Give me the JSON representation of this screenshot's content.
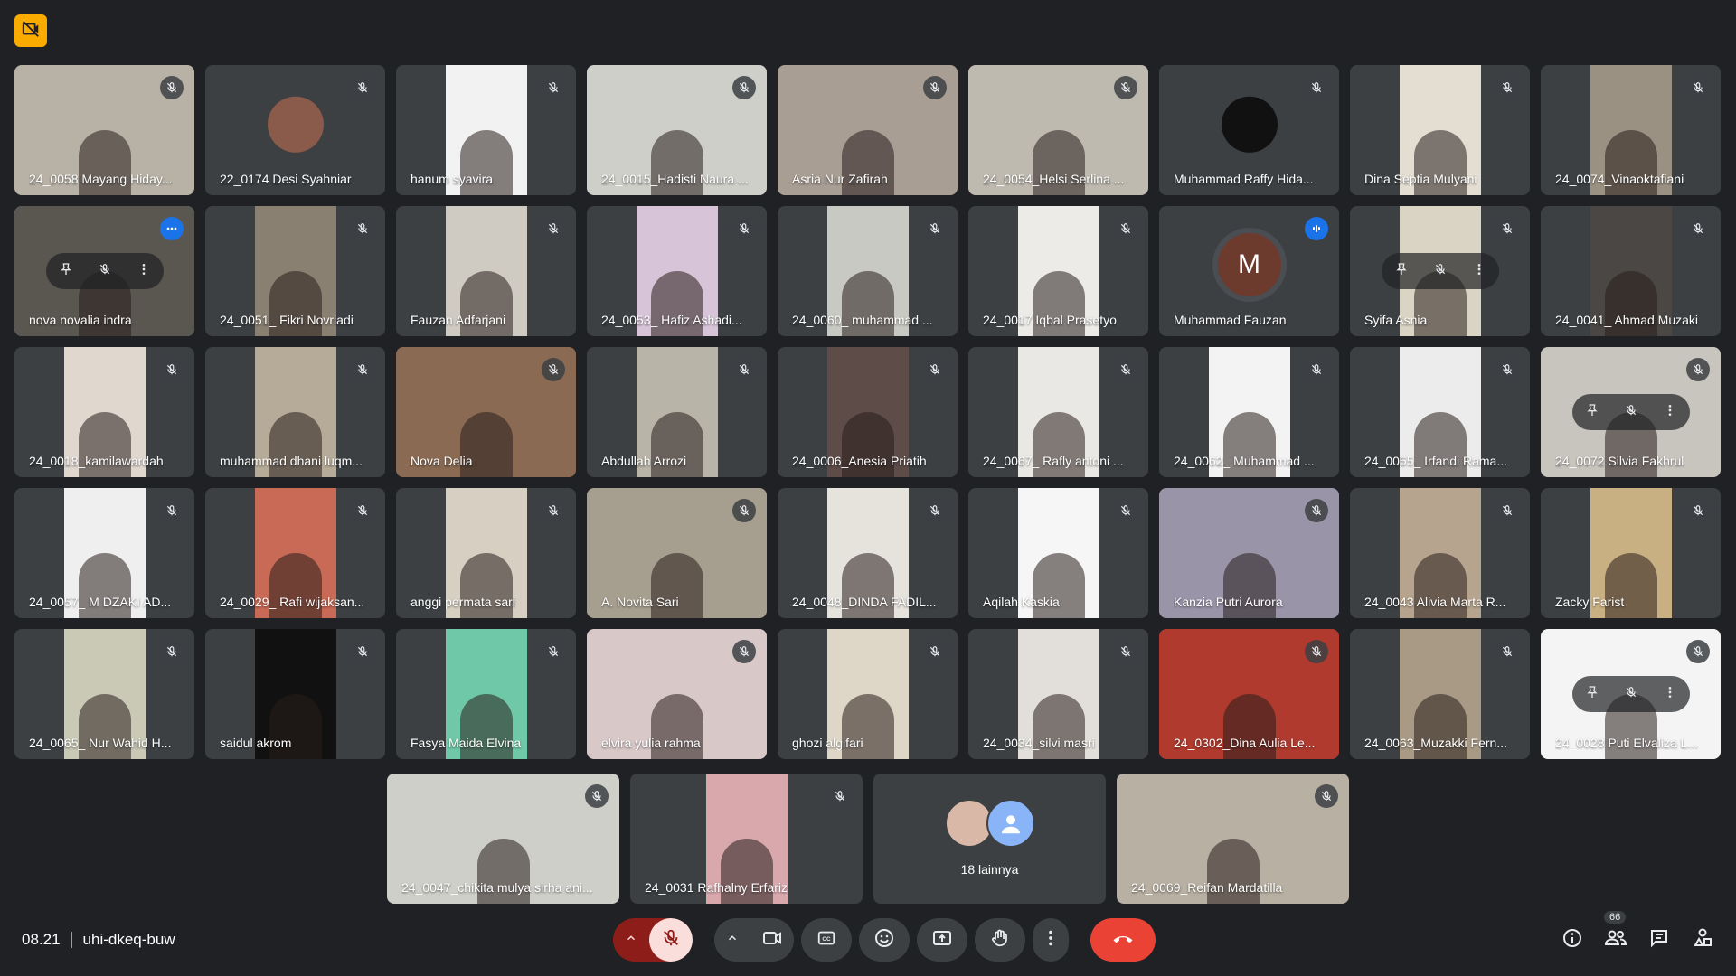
{
  "meeting": {
    "time": "08.21",
    "code": "uhi-dkeq-buw"
  },
  "participant_count": "66",
  "others_label": "18 lainnya",
  "colors": {
    "tile_bg": "#3c4043",
    "page_bg": "#202124",
    "end_call": "#ea4335",
    "active_border": "#8ab4f8",
    "speaking": "#1a73e8"
  },
  "participants": [
    {
      "name": "24_0058 Mayang Hiday...",
      "mode": "full",
      "bg": "#b8b2a6"
    },
    {
      "name": "22_0174 Desi Syahniar",
      "mode": "avatar",
      "avatar": "#8a5a4a"
    },
    {
      "name": "hanum syavira",
      "mode": "video",
      "bg": "#f2f2f2"
    },
    {
      "name": "24_0015_Hadisti Naura ...",
      "mode": "full",
      "bg": "#cfcfca"
    },
    {
      "name": "Asria Nur Zafirah",
      "mode": "full",
      "bg": "#a99e94"
    },
    {
      "name": "24_0054_Helsi Serlina ...",
      "mode": "full",
      "bg": "#bfbab0"
    },
    {
      "name": "Muhammad Raffy Hida...",
      "mode": "avatar",
      "avatar": "#111111"
    },
    {
      "name": "Dina Septia Mulyani",
      "mode": "video",
      "bg": "#e3ddd2"
    },
    {
      "name": "24_0074_Vinaoktafiani",
      "mode": "video",
      "bg": "#9a9182"
    },
    {
      "name": "nova novalia indra",
      "mode": "full",
      "bg": "#5a5650",
      "active": true,
      "badge": "more",
      "hover": true
    },
    {
      "name": "24_0051_ Fikri Novriadi",
      "mode": "video",
      "bg": "#8a8072"
    },
    {
      "name": "Fauzan Adfarjani",
      "mode": "video",
      "bg": "#cfcac2"
    },
    {
      "name": "24_0053_ Hafiz Ashadi...",
      "mode": "video",
      "bg": "#d7c4d8"
    },
    {
      "name": "24_0060_ muhammad ...",
      "mode": "video",
      "bg": "#c9c9c4"
    },
    {
      "name": "24_0017 Iqbal Prasetyo",
      "mode": "video",
      "bg": "#ecebe8"
    },
    {
      "name": "Muhammad Fauzan",
      "mode": "letter",
      "letter": "M",
      "avatar": "#6d3a2e",
      "badge": "speak"
    },
    {
      "name": "Syifa Asnia",
      "mode": "video",
      "bg": "#dad4c4",
      "hover": true
    },
    {
      "name": "24_0041_ Ahmad Muzaki",
      "mode": "video",
      "bg": "#4a4744"
    },
    {
      "name": "24_0018_kamilawardah",
      "mode": "video",
      "bg": "#e0d7cf"
    },
    {
      "name": "muhammad dhani luqm...",
      "mode": "video",
      "bg": "#b6ab98"
    },
    {
      "name": "Nova Delia",
      "mode": "full",
      "bg": "#8a6a52"
    },
    {
      "name": "Abdullah Arrozi",
      "mode": "video",
      "bg": "#b9b4a8"
    },
    {
      "name": "24_0006_Anesia Priatih",
      "mode": "video",
      "bg": "#5e4c48"
    },
    {
      "name": "24_0067_ Rafly antoni ...",
      "mode": "video",
      "bg": "#eae8e4"
    },
    {
      "name": "24_0062_ Muhammad ...",
      "mode": "video",
      "bg": "#f3f3f3"
    },
    {
      "name": "24_0055_ Irfandi Rama...",
      "mode": "video",
      "bg": "#ececec"
    },
    {
      "name": "24_0072 Silvia Fakhrul",
      "mode": "full",
      "bg": "#c8c4be",
      "hover": true
    },
    {
      "name": "24_0057_ M DZAKI AD...",
      "mode": "video",
      "bg": "#efefef"
    },
    {
      "name": "24_0029_ Rafi wijaksan...",
      "mode": "video",
      "bg": "#c86a56"
    },
    {
      "name": "anggi permata sari",
      "mode": "video",
      "bg": "#d6cfc2"
    },
    {
      "name": "A. Novita Sari",
      "mode": "full",
      "bg": "#a69e8e"
    },
    {
      "name": "24_0048_DINDA FADIL...",
      "mode": "video",
      "bg": "#e6e3dd"
    },
    {
      "name": "Aqilah Kaskia",
      "mode": "video",
      "bg": "#f6f6f6"
    },
    {
      "name": "Kanzia Putri Aurora",
      "mode": "full",
      "bg": "#9a94a8"
    },
    {
      "name": "24_0043 Alivia Marta R...",
      "mode": "video",
      "bg": "#b7a48e"
    },
    {
      "name": "Zacky Farist",
      "mode": "video",
      "bg": "#c9b083"
    },
    {
      "name": "24_0065_ Nur Wahid H...",
      "mode": "video",
      "bg": "#c9c9b6"
    },
    {
      "name": "saidul akrom",
      "mode": "video",
      "bg": "#111111"
    },
    {
      "name": "Fasya Maida Elvina",
      "mode": "video",
      "bg": "#6fc9a8"
    },
    {
      "name": "elvira yulia rahma",
      "mode": "full",
      "bg": "#d8c8c8"
    },
    {
      "name": "ghozi algifari",
      "mode": "video",
      "bg": "#ded6c6"
    },
    {
      "name": "24_0034_silvi masri",
      "mode": "video",
      "bg": "#e2dfda"
    },
    {
      "name": "24_0302_Dina Aulia Le...",
      "mode": "full",
      "bg": "#b03a2e"
    },
    {
      "name": "24_0063_Muzakki Fern...",
      "mode": "video",
      "bg": "#a89a84"
    },
    {
      "name": "24_0028 Puti Elvaliza L...",
      "mode": "full",
      "bg": "#f4f4f4",
      "hover": true
    }
  ],
  "last_row": [
    {
      "name": "24_0047_chikita mulya sirha ani...",
      "mode": "full",
      "bg": "#cfcfca"
    },
    {
      "name": "24_0031 Rafhalny Erfariz",
      "mode": "video",
      "bg": "#d8a8ad"
    },
    {
      "name": "24_0069_Reifan Mardatilla",
      "mode": "full",
      "bg": "#b8b0a2"
    }
  ],
  "icons": {
    "rec": "no-recording-icon",
    "mic_off": "mic-off-icon",
    "pin": "pin-icon",
    "more": "more-vert-icon",
    "camera": "videocam-icon",
    "captions": "closed-caption-icon",
    "emoji": "emoji-icon",
    "present": "present-screen-icon",
    "hand": "raise-hand-icon",
    "end": "end-call-icon",
    "info": "info-icon",
    "people": "people-icon",
    "chat": "chat-icon",
    "activities": "activities-icon"
  }
}
